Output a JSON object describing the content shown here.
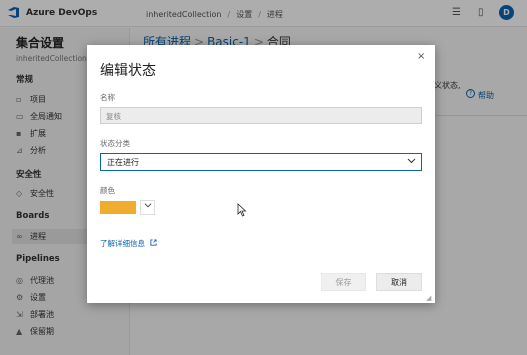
{
  "topbar": {
    "brand": "Azure DevOps",
    "breadcrumb": [
      "inheritedCollection",
      "设置",
      "进程"
    ],
    "avatar_initial": "D"
  },
  "sidebar": {
    "title": "集合设置",
    "subtitle": "inheritedCollection",
    "sections": {
      "general": "常规",
      "security": "安全性",
      "boards": "Boards",
      "pipelines": "Pipelines"
    },
    "items": {
      "projects": "项目",
      "notifications": "全局通知",
      "extensions": "扩展",
      "analytics": "分析",
      "security": "安全性",
      "process": "进程",
      "agent_pools": "代理池",
      "settings": "设置",
      "deployment_pools": "部署池",
      "retention": "保留期"
    }
  },
  "main": {
    "crumb_root": "所有进程",
    "crumb_process": "Basic-1",
    "crumb_current": "合同",
    "bg_fragment": "义状态,",
    "help_label": "帮助"
  },
  "dialog": {
    "title": "编辑状态",
    "close_glyph": "×",
    "name_label": "名称",
    "name_value": "复核",
    "category_label": "状态分类",
    "category_value": "正在进行",
    "color_label": "颜色",
    "color_value": "#f0ac2e",
    "learn_more": "了解详细信息",
    "save_label": "保存",
    "cancel_label": "取消"
  }
}
